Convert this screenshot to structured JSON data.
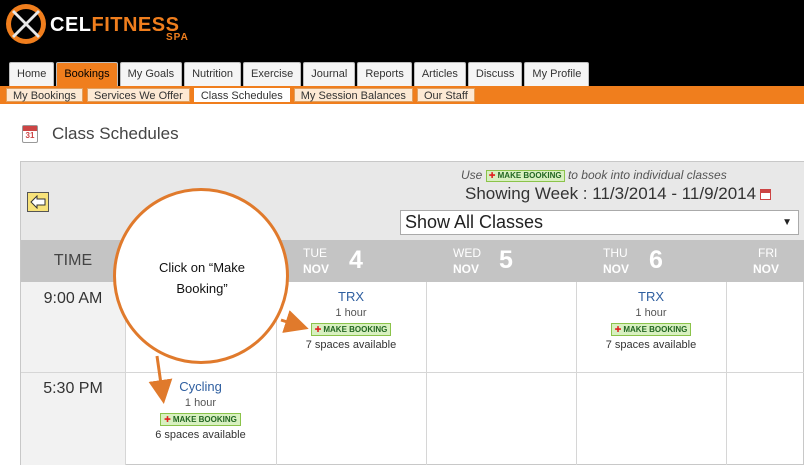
{
  "brand": {
    "main_prefix": "X",
    "main_rest": "CEL",
    "main_accent": "FITNESS",
    "sub": "SPA"
  },
  "tabs": [
    {
      "label": "Home"
    },
    {
      "label": "Bookings",
      "active": true
    },
    {
      "label": "My Goals"
    },
    {
      "label": "Nutrition"
    },
    {
      "label": "Exercise"
    },
    {
      "label": "Journal"
    },
    {
      "label": "Reports"
    },
    {
      "label": "Articles"
    },
    {
      "label": "Discuss"
    },
    {
      "label": "My Profile"
    }
  ],
  "subnav": [
    {
      "label": "My Bookings"
    },
    {
      "label": "Services We Offer"
    },
    {
      "label": "Class Schedules",
      "active": true
    },
    {
      "label": "My Session Balances"
    },
    {
      "label": "Our Staff"
    }
  ],
  "page": {
    "title": "Class Schedules",
    "icon_number": "31"
  },
  "toolbar": {
    "use_prefix": "Use",
    "use_button": "MAKE BOOKING",
    "use_suffix": "to book into individual classes",
    "week": "Showing Week : 11/3/2014 - 11/9/2014",
    "filter_value": "Show All Classes"
  },
  "schedule": {
    "time_header": "TIME",
    "days": [
      {
        "dow": "TUE",
        "mon": "NOV",
        "num": "4"
      },
      {
        "dow": "WED",
        "mon": "NOV",
        "num": "5"
      },
      {
        "dow": "THU",
        "mon": "NOV",
        "num": "6"
      },
      {
        "dow": "FRI",
        "mon": "NOV",
        "num": ""
      }
    ],
    "times": [
      "9:00 AM",
      "5:30 PM"
    ],
    "classes": [
      {
        "name": "TRX",
        "duration": "1 hour",
        "button": "MAKE BOOKING",
        "spaces": "7 spaces available"
      },
      {
        "name": "TRX",
        "duration": "1 hour",
        "button": "MAKE BOOKING",
        "spaces": "7 spaces available"
      },
      {
        "name": "Cycling",
        "duration": "1 hour",
        "button": "MAKE BOOKING",
        "spaces": "6 spaces available"
      }
    ]
  },
  "annotation": {
    "text": "Click on “Make Booking”",
    "color": "#e07a2c"
  },
  "colors": {
    "accent": "#f07e1d",
    "header_bg": "#000000",
    "link": "#2f5fa0",
    "book_bg": "#d8f0c0"
  }
}
